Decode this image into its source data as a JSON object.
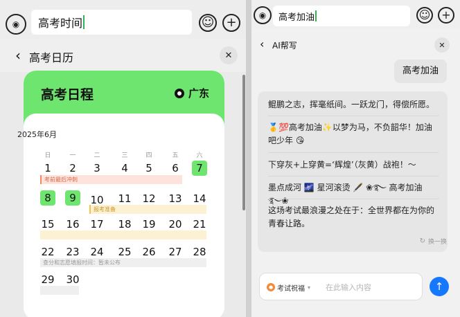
{
  "left": {
    "search_value": "高考时间",
    "title": "高考日历",
    "calendar": {
      "title": "高考日程",
      "location": "广东",
      "month": "2025年6月",
      "weekdays": [
        "日",
        "一",
        "二",
        "三",
        "四",
        "五",
        "六"
      ],
      "days": [
        "1",
        "2",
        "3",
        "4",
        "5",
        "6",
        "7",
        "8",
        "9",
        "10",
        "11",
        "12",
        "13",
        "14",
        "15",
        "16",
        "17",
        "18",
        "19",
        "20",
        "21",
        "22",
        "23",
        "24",
        "25",
        "26",
        "27",
        "28",
        "29",
        "30"
      ],
      "events": {
        "sprint": "考前最后冲刺",
        "prepare": "报考准备",
        "score": "查分和志愿填报时间：暂未公布"
      }
    }
  },
  "right": {
    "search_value": "高考加油",
    "title": "AI帮写",
    "user_message": "高考加油",
    "replies": [
      "鲲鹏之志，挥毫纸间。一跃龙门，得偿所愿。",
      "🥇💯高考加油✨以梦为马，不负韶华！加油吧少年 😘",
      "下穿灰+上穿黄=‘辉煌’（灰黄）战袍！～",
      "墨点成河 🌌 星河滚烫 🖋️ ❀࿐ 高考加油 ࿐❀",
      "这场考试最浪漫之处在于：全世界都在为你的青春让路。"
    ],
    "refresh_label": "换一换",
    "tag_label": "考试祝福",
    "input_placeholder": "在此输入内容"
  },
  "colors": {
    "accent_green": "#6ee56e",
    "send_blue": "#1677ff",
    "event_red": "#f08a63",
    "event_yellow": "#f1c04d"
  }
}
